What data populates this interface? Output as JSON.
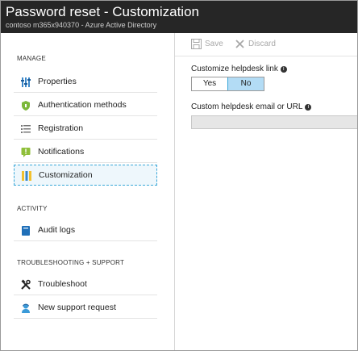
{
  "header": {
    "title": "Password reset - Customization",
    "subtitle": "contoso m365x940370 - Azure Active Directory"
  },
  "sidebar": {
    "sections": [
      {
        "label": "MANAGE"
      },
      {
        "label": "ACTIVITY"
      },
      {
        "label": "TROUBLESHOOTING + SUPPORT"
      }
    ],
    "items": [
      {
        "label": "Properties",
        "icon": "properties-icon"
      },
      {
        "label": "Authentication methods",
        "icon": "shield-icon"
      },
      {
        "label": "Registration",
        "icon": "list-icon"
      },
      {
        "label": "Notifications",
        "icon": "notification-icon"
      },
      {
        "label": "Customization",
        "icon": "customization-icon",
        "selected": true
      },
      {
        "label": "Audit logs",
        "icon": "book-icon"
      },
      {
        "label": "Troubleshoot",
        "icon": "tools-icon"
      },
      {
        "label": "New support request",
        "icon": "support-person-icon"
      }
    ]
  },
  "toolbar": {
    "save_label": "Save",
    "discard_label": "Discard"
  },
  "form": {
    "helpdesk_link_label": "Customize helpdesk link",
    "toggle_yes": "Yes",
    "toggle_no": "No",
    "toggle_selected": "No",
    "email_label": "Custom helpdesk email or URL",
    "email_value": ""
  },
  "colors": {
    "titlebar": "#262626",
    "accent": "#3aa7d8",
    "toggle_selected_bg": "#b3dcf5"
  }
}
